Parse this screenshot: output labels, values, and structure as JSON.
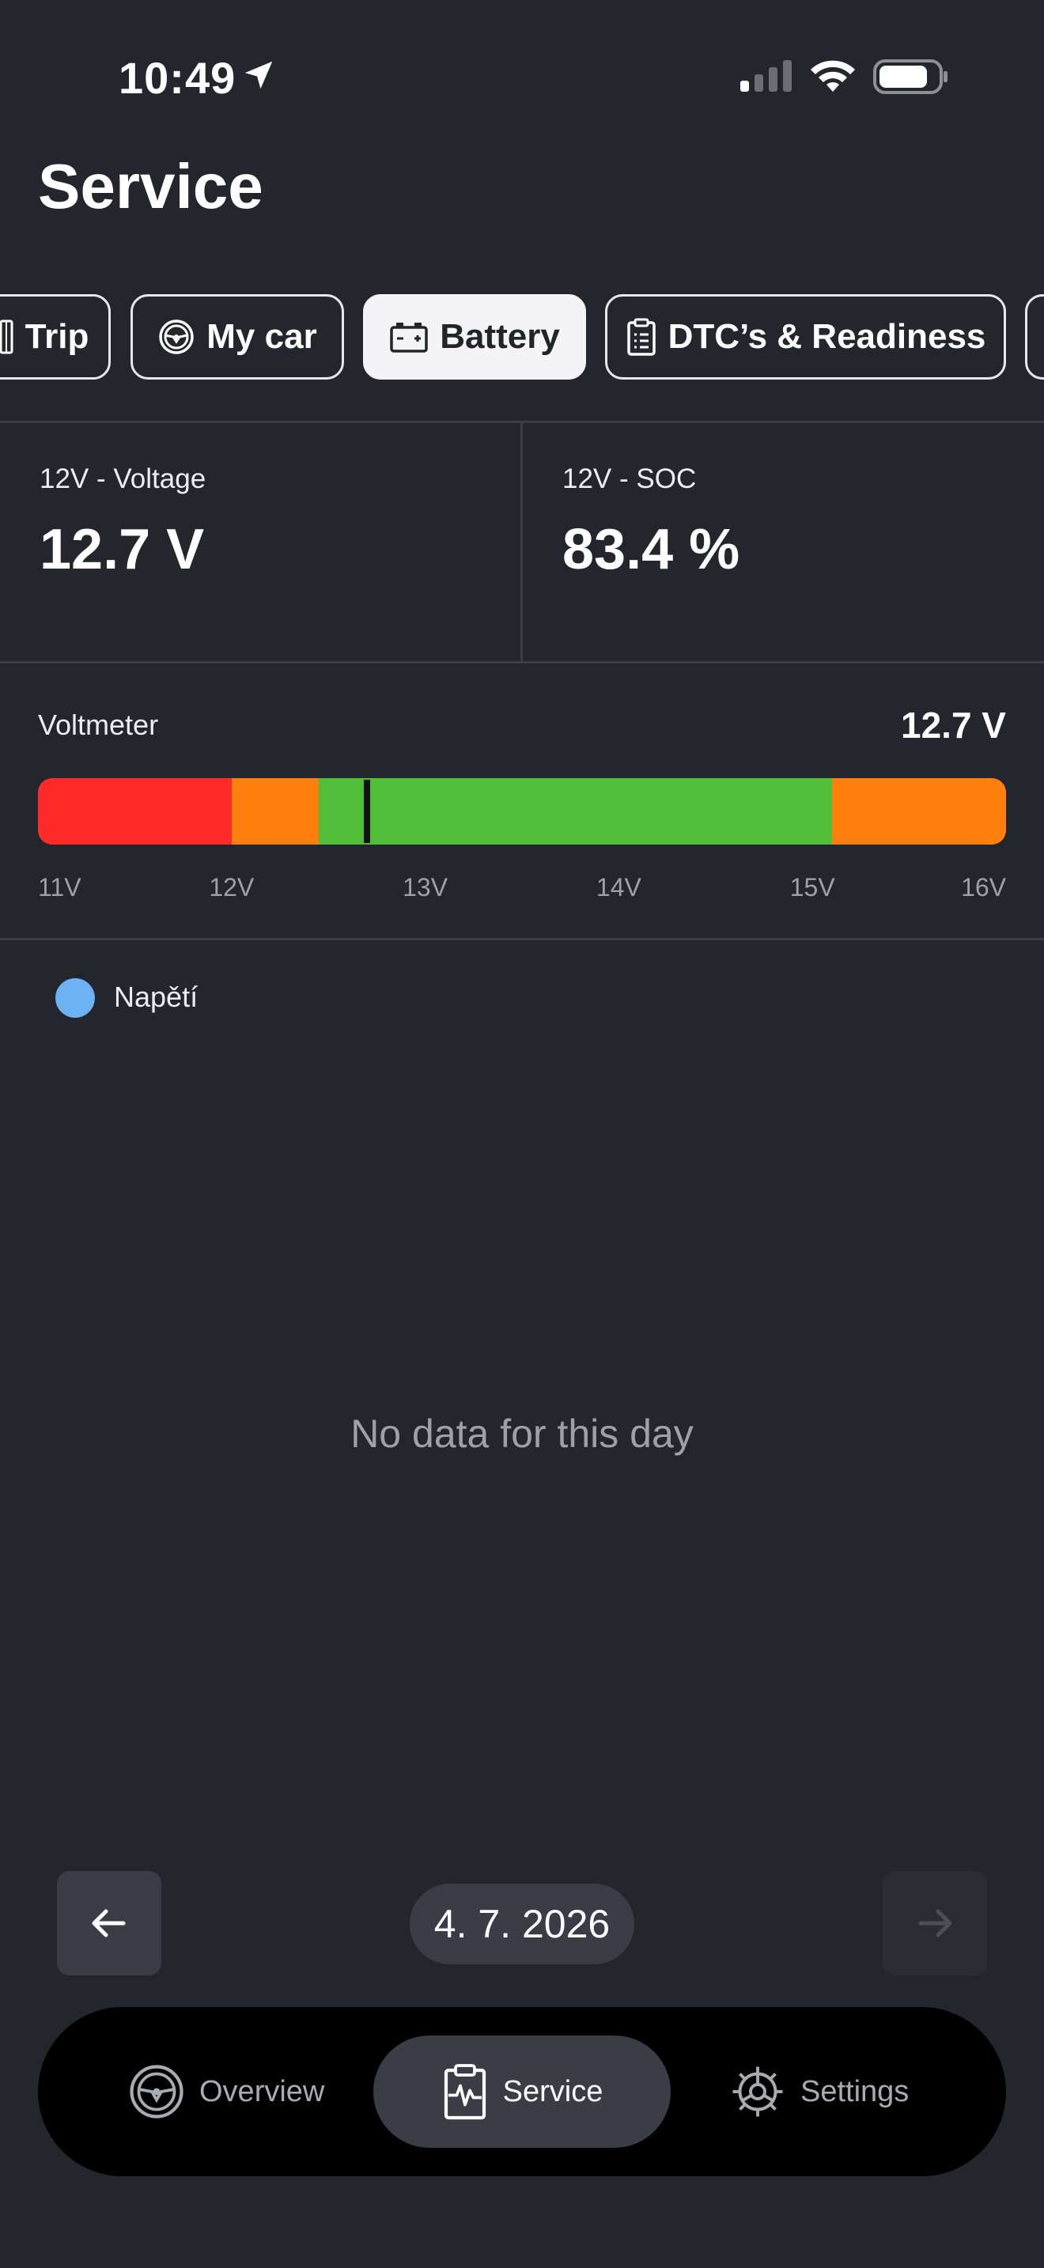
{
  "status": {
    "time": "10:49"
  },
  "header": {
    "title": "Service"
  },
  "tabs": [
    {
      "label": "Trip",
      "icon": "trip-icon",
      "active": false
    },
    {
      "label": "My car",
      "icon": "steering-wheel-icon",
      "active": false
    },
    {
      "label": "Battery",
      "icon": "battery-icon",
      "active": true
    },
    {
      "label": "DTC’s & Readiness",
      "icon": "clipboard-icon",
      "active": false
    }
  ],
  "stats": [
    {
      "label": "12V - Voltage",
      "value": "12.7 V"
    },
    {
      "label": "12V - SOC",
      "value": "83.4 %"
    }
  ],
  "voltmeter": {
    "label": "Voltmeter",
    "value_text": "12.7 V",
    "value": 12.7,
    "range": [
      11,
      16
    ],
    "ticks": [
      "11V",
      "12V",
      "13V",
      "14V",
      "15V",
      "16V"
    ],
    "segments": [
      {
        "from": 11.0,
        "to": 12.0,
        "color": "#ff2b2b"
      },
      {
        "from": 12.0,
        "to": 12.45,
        "color": "#ff800f"
      },
      {
        "from": 12.45,
        "to": 15.1,
        "color": "#52be39"
      },
      {
        "from": 15.1,
        "to": 16.0,
        "color": "#ff800f"
      }
    ]
  },
  "chart": {
    "legend": {
      "label": "Napětí",
      "color": "#6db2f2"
    },
    "empty_text": "No data for this day"
  },
  "date_nav": {
    "date": "4. 7. 2026",
    "prev_icon": "arrow-left-icon",
    "next_icon": "arrow-right-icon"
  },
  "bottom_nav": [
    {
      "label": "Overview",
      "icon": "steering-wheel-icon",
      "active": false
    },
    {
      "label": "Service",
      "icon": "clipboard-pulse-icon",
      "active": true
    },
    {
      "label": "Settings",
      "icon": "gear-icon",
      "active": false
    }
  ]
}
